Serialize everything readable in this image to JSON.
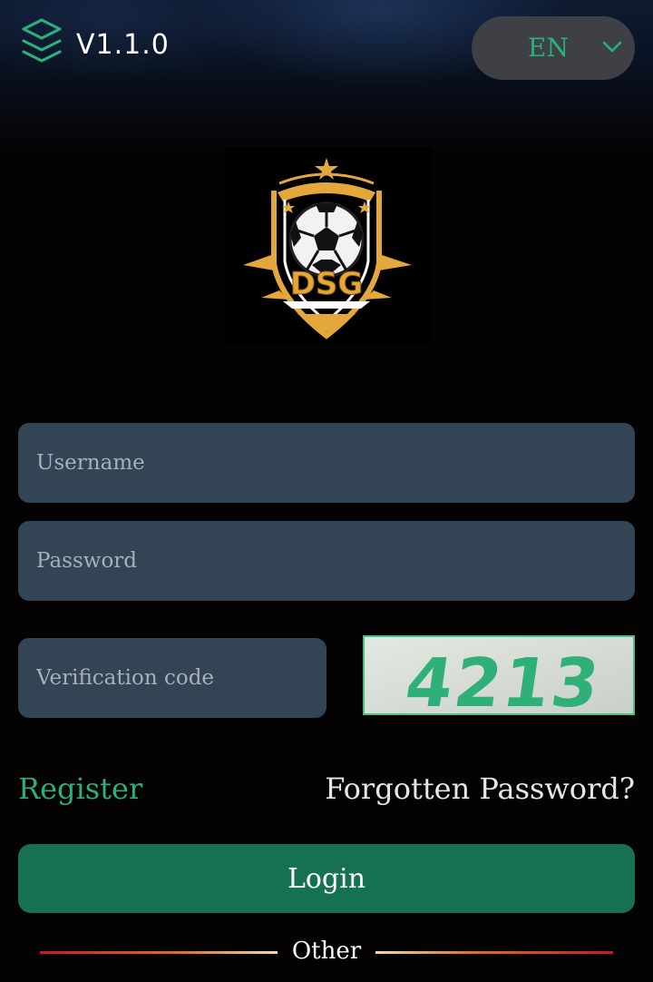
{
  "header": {
    "version": "V1.1.0",
    "language": {
      "selected": "EN"
    }
  },
  "brand": {
    "logo_icon": "dsg-championship-shield-logo"
  },
  "form": {
    "username_placeholder": "Username",
    "password_placeholder": "Password",
    "verification_placeholder": "Verification code",
    "captcha_code": "4213"
  },
  "links": {
    "register": "Register",
    "forgot": "Forgotten Password?"
  },
  "login_label": "Login",
  "other_label": "Other",
  "colors": {
    "accent_green": "#2ab07a",
    "button_green": "#157152",
    "field_bg": "#334455",
    "background": "#050203",
    "gold": "#e3a73c"
  }
}
